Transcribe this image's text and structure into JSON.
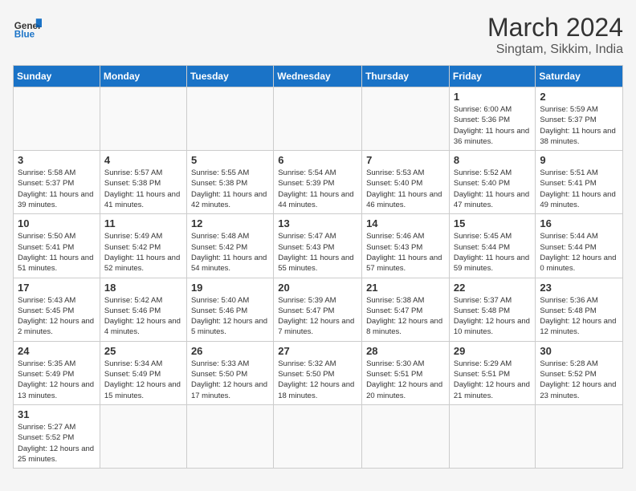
{
  "header": {
    "logo_general": "General",
    "logo_blue": "Blue",
    "month_year": "March 2024",
    "location": "Singtam, Sikkim, India"
  },
  "columns": [
    "Sunday",
    "Monday",
    "Tuesday",
    "Wednesday",
    "Thursday",
    "Friday",
    "Saturday"
  ],
  "weeks": [
    [
      {
        "day": "",
        "info": ""
      },
      {
        "day": "",
        "info": ""
      },
      {
        "day": "",
        "info": ""
      },
      {
        "day": "",
        "info": ""
      },
      {
        "day": "",
        "info": ""
      },
      {
        "day": "1",
        "info": "Sunrise: 6:00 AM\nSunset: 5:36 PM\nDaylight: 11 hours and 36 minutes."
      },
      {
        "day": "2",
        "info": "Sunrise: 5:59 AM\nSunset: 5:37 PM\nDaylight: 11 hours and 38 minutes."
      }
    ],
    [
      {
        "day": "3",
        "info": "Sunrise: 5:58 AM\nSunset: 5:37 PM\nDaylight: 11 hours and 39 minutes."
      },
      {
        "day": "4",
        "info": "Sunrise: 5:57 AM\nSunset: 5:38 PM\nDaylight: 11 hours and 41 minutes."
      },
      {
        "day": "5",
        "info": "Sunrise: 5:55 AM\nSunset: 5:38 PM\nDaylight: 11 hours and 42 minutes."
      },
      {
        "day": "6",
        "info": "Sunrise: 5:54 AM\nSunset: 5:39 PM\nDaylight: 11 hours and 44 minutes."
      },
      {
        "day": "7",
        "info": "Sunrise: 5:53 AM\nSunset: 5:40 PM\nDaylight: 11 hours and 46 minutes."
      },
      {
        "day": "8",
        "info": "Sunrise: 5:52 AM\nSunset: 5:40 PM\nDaylight: 11 hours and 47 minutes."
      },
      {
        "day": "9",
        "info": "Sunrise: 5:51 AM\nSunset: 5:41 PM\nDaylight: 11 hours and 49 minutes."
      }
    ],
    [
      {
        "day": "10",
        "info": "Sunrise: 5:50 AM\nSunset: 5:41 PM\nDaylight: 11 hours and 51 minutes."
      },
      {
        "day": "11",
        "info": "Sunrise: 5:49 AM\nSunset: 5:42 PM\nDaylight: 11 hours and 52 minutes."
      },
      {
        "day": "12",
        "info": "Sunrise: 5:48 AM\nSunset: 5:42 PM\nDaylight: 11 hours and 54 minutes."
      },
      {
        "day": "13",
        "info": "Sunrise: 5:47 AM\nSunset: 5:43 PM\nDaylight: 11 hours and 55 minutes."
      },
      {
        "day": "14",
        "info": "Sunrise: 5:46 AM\nSunset: 5:43 PM\nDaylight: 11 hours and 57 minutes."
      },
      {
        "day": "15",
        "info": "Sunrise: 5:45 AM\nSunset: 5:44 PM\nDaylight: 11 hours and 59 minutes."
      },
      {
        "day": "16",
        "info": "Sunrise: 5:44 AM\nSunset: 5:44 PM\nDaylight: 12 hours and 0 minutes."
      }
    ],
    [
      {
        "day": "17",
        "info": "Sunrise: 5:43 AM\nSunset: 5:45 PM\nDaylight: 12 hours and 2 minutes."
      },
      {
        "day": "18",
        "info": "Sunrise: 5:42 AM\nSunset: 5:46 PM\nDaylight: 12 hours and 4 minutes."
      },
      {
        "day": "19",
        "info": "Sunrise: 5:40 AM\nSunset: 5:46 PM\nDaylight: 12 hours and 5 minutes."
      },
      {
        "day": "20",
        "info": "Sunrise: 5:39 AM\nSunset: 5:47 PM\nDaylight: 12 hours and 7 minutes."
      },
      {
        "day": "21",
        "info": "Sunrise: 5:38 AM\nSunset: 5:47 PM\nDaylight: 12 hours and 8 minutes."
      },
      {
        "day": "22",
        "info": "Sunrise: 5:37 AM\nSunset: 5:48 PM\nDaylight: 12 hours and 10 minutes."
      },
      {
        "day": "23",
        "info": "Sunrise: 5:36 AM\nSunset: 5:48 PM\nDaylight: 12 hours and 12 minutes."
      }
    ],
    [
      {
        "day": "24",
        "info": "Sunrise: 5:35 AM\nSunset: 5:49 PM\nDaylight: 12 hours and 13 minutes."
      },
      {
        "day": "25",
        "info": "Sunrise: 5:34 AM\nSunset: 5:49 PM\nDaylight: 12 hours and 15 minutes."
      },
      {
        "day": "26",
        "info": "Sunrise: 5:33 AM\nSunset: 5:50 PM\nDaylight: 12 hours and 17 minutes."
      },
      {
        "day": "27",
        "info": "Sunrise: 5:32 AM\nSunset: 5:50 PM\nDaylight: 12 hours and 18 minutes."
      },
      {
        "day": "28",
        "info": "Sunrise: 5:30 AM\nSunset: 5:51 PM\nDaylight: 12 hours and 20 minutes."
      },
      {
        "day": "29",
        "info": "Sunrise: 5:29 AM\nSunset: 5:51 PM\nDaylight: 12 hours and 21 minutes."
      },
      {
        "day": "30",
        "info": "Sunrise: 5:28 AM\nSunset: 5:52 PM\nDaylight: 12 hours and 23 minutes."
      }
    ],
    [
      {
        "day": "31",
        "info": "Sunrise: 5:27 AM\nSunset: 5:52 PM\nDaylight: 12 hours and 25 minutes."
      },
      {
        "day": "",
        "info": ""
      },
      {
        "day": "",
        "info": ""
      },
      {
        "day": "",
        "info": ""
      },
      {
        "day": "",
        "info": ""
      },
      {
        "day": "",
        "info": ""
      },
      {
        "day": "",
        "info": ""
      }
    ]
  ]
}
